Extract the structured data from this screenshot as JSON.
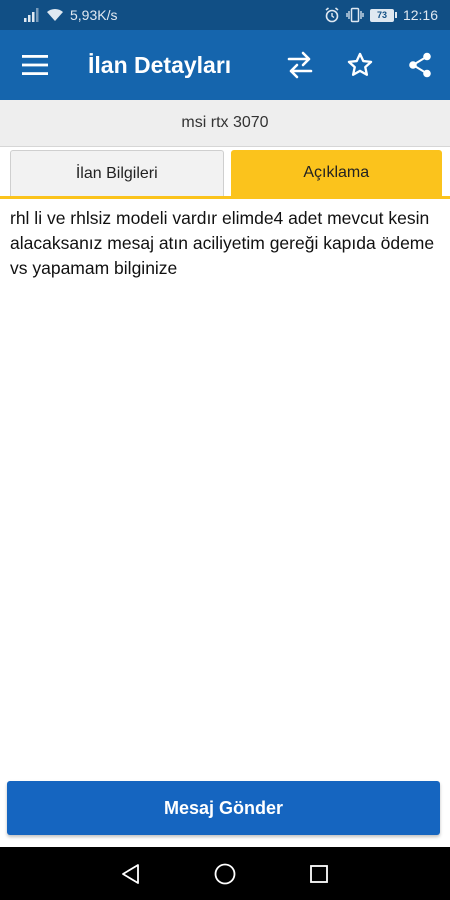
{
  "status_bar": {
    "network_speed": "5,93K/s",
    "battery_level": "73",
    "time": "12:16"
  },
  "app_bar": {
    "title": "İlan Detayları",
    "background_color": "#1565ad"
  },
  "listing": {
    "title": "msi rtx 3070"
  },
  "tabs": [
    {
      "label": "İlan Bilgileri",
      "active": false
    },
    {
      "label": "Açıklama",
      "active": true
    }
  ],
  "description": {
    "text": "rhl li ve rhlsiz modeli vardır elimde4 adet mevcut kesin alacaksanız mesaj atın aciliyetim gereği kapıda ödeme vs yapamam bilginize"
  },
  "footer": {
    "send_message_label": "Mesaj Gönder"
  },
  "colors": {
    "status_bar": "#114f85",
    "accent": "#fbc31c",
    "primary_button": "#1565c0"
  },
  "icons": {
    "menu": "hamburger-menu-icon",
    "compare": "swap-arrows-icon",
    "favorite": "star-outline-icon",
    "share": "share-icon"
  }
}
